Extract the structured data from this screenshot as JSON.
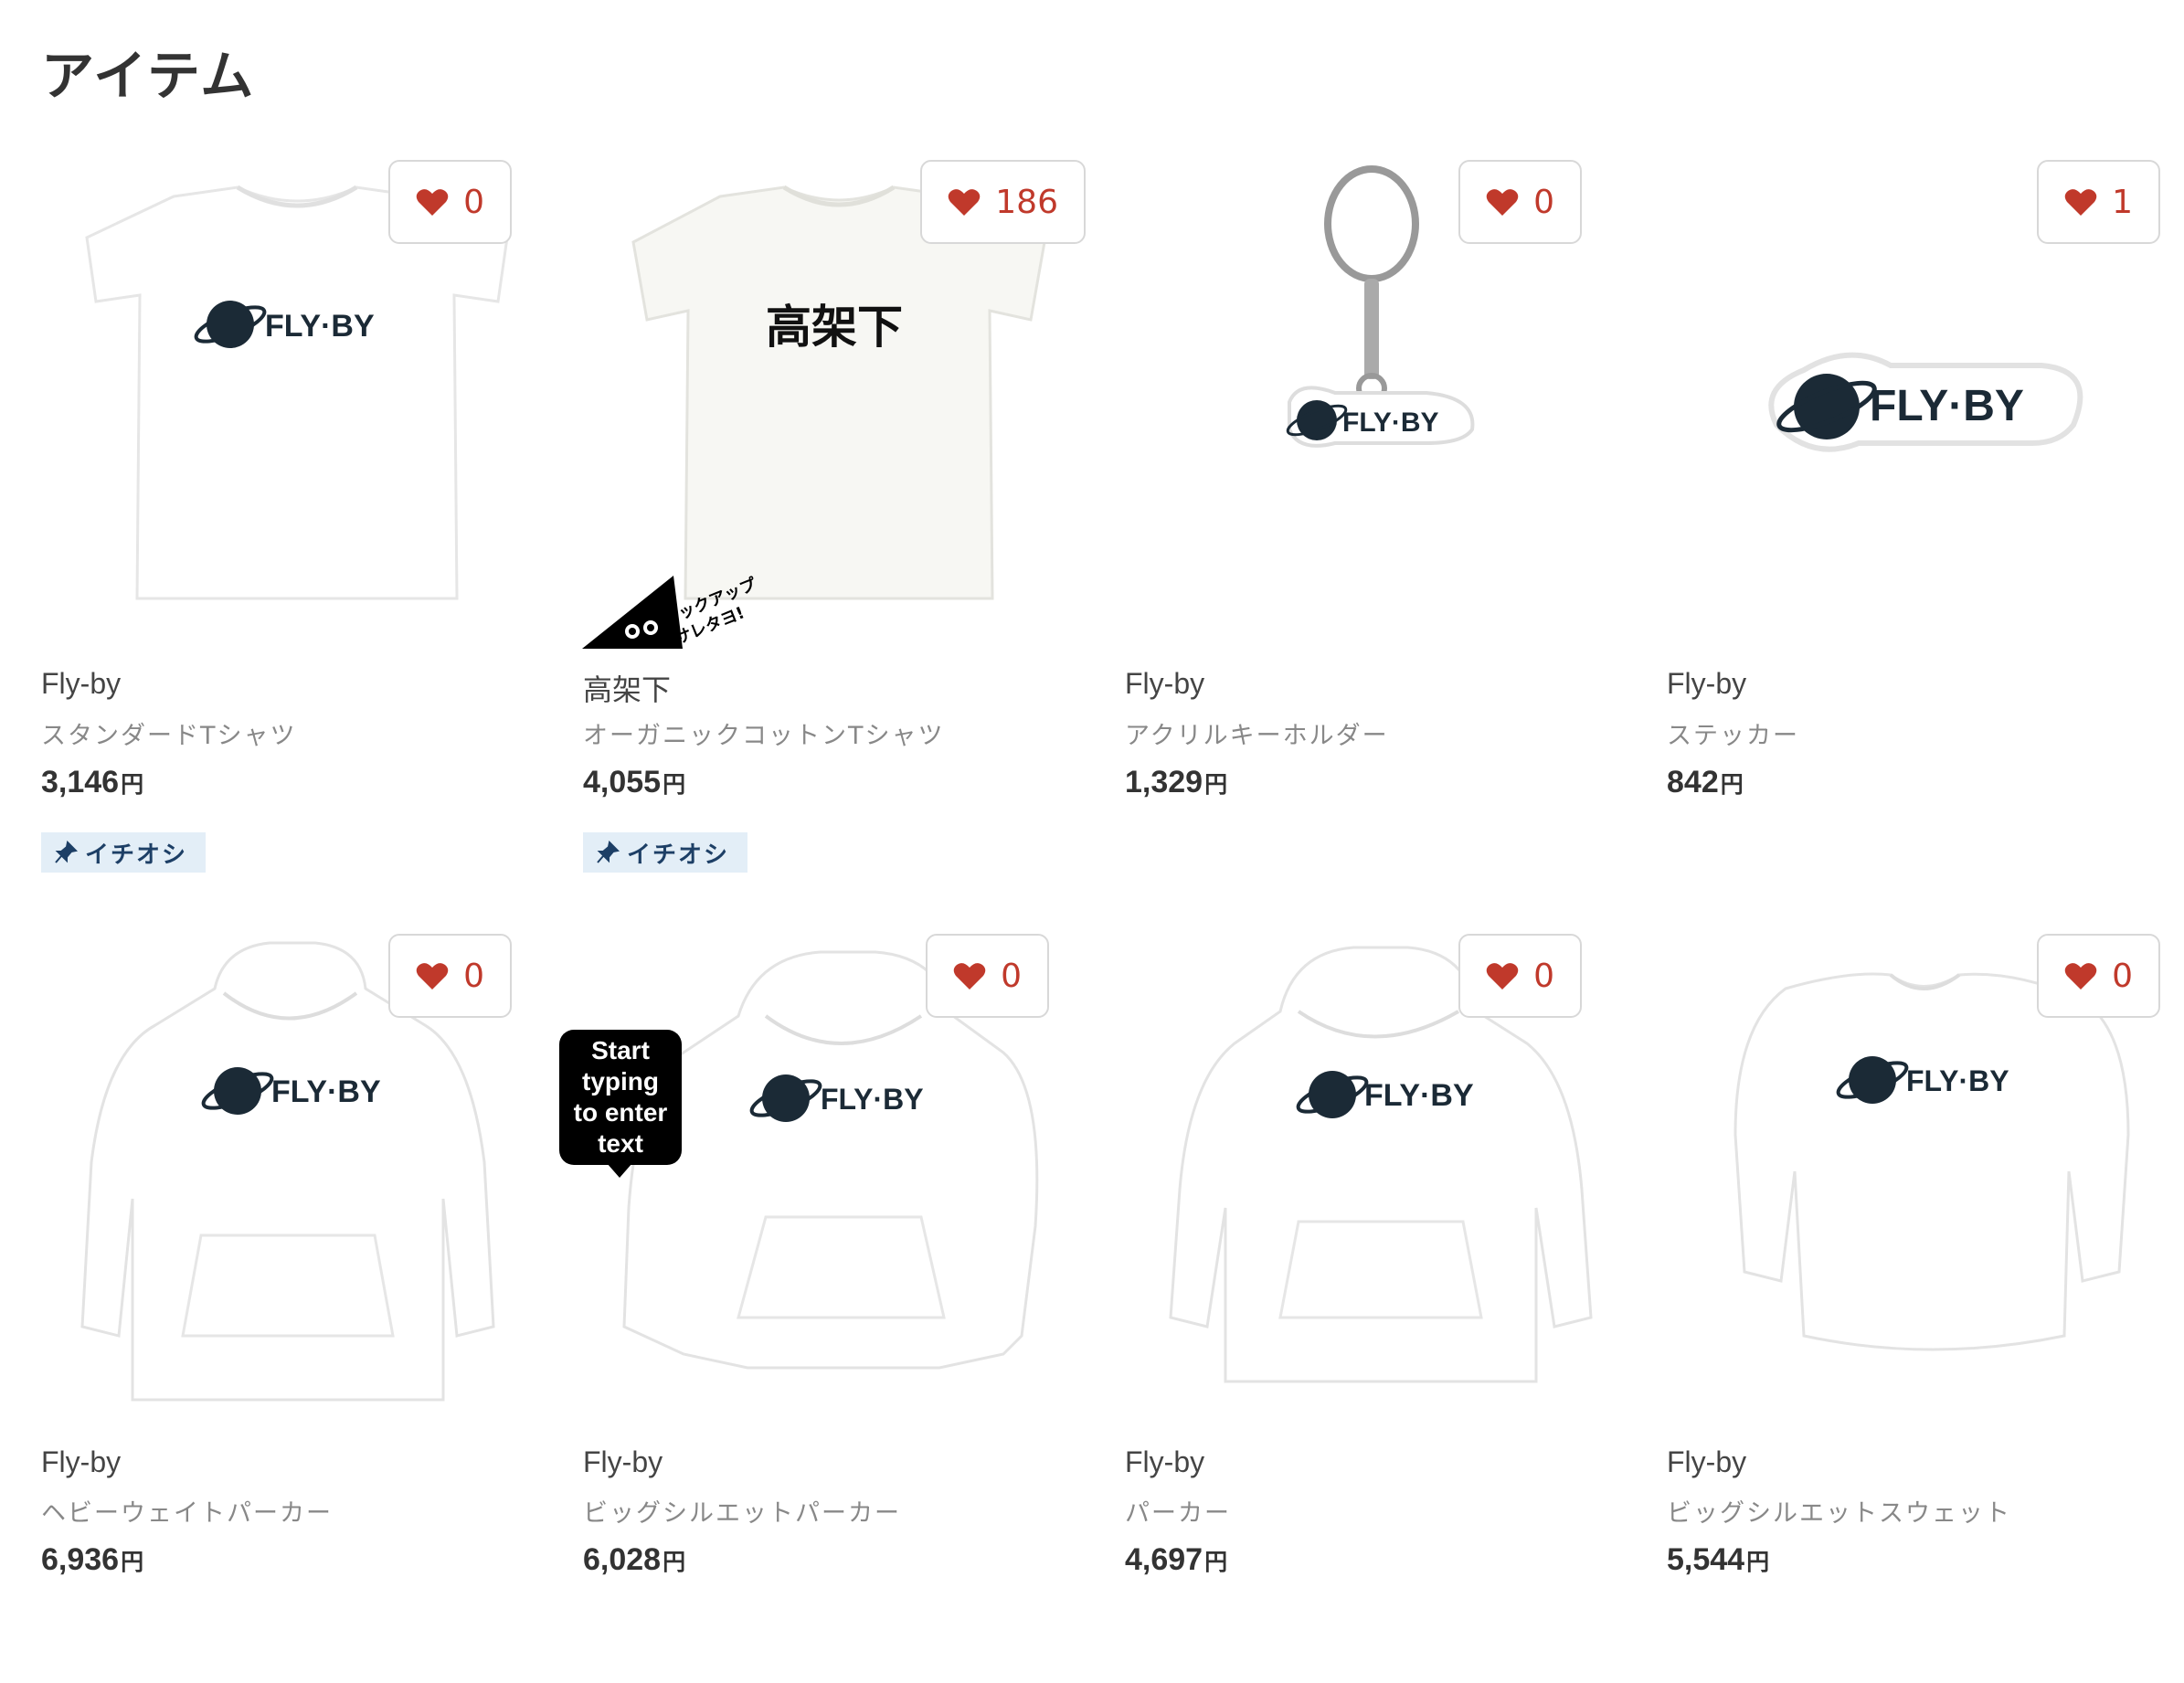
{
  "page": {
    "title": "アイテム"
  },
  "items": [
    {
      "shop": "Fly-by",
      "type": "スタンダードTシャツ",
      "price": "3,146",
      "currency": "円",
      "likes": "0",
      "badge": "イチオシ",
      "image": "tshirt",
      "print": "FLY·BY"
    },
    {
      "shop": "高架下",
      "type": "オーガニックコットンTシャツ",
      "price": "4,055",
      "currency": "円",
      "likes": "186",
      "badge": "イチオシ",
      "image": "tshirt",
      "print": "高架下"
    },
    {
      "shop": "Fly-by",
      "type": "アクリルキーホルダー",
      "price": "1,329",
      "currency": "円",
      "likes": "0",
      "badge": "",
      "image": "keychain",
      "print": "FLY·BY"
    },
    {
      "shop": "Fly-by",
      "type": "ステッカー",
      "price": "842",
      "currency": "円",
      "likes": "1",
      "badge": "",
      "image": "sticker",
      "print": "FLY·BY"
    },
    {
      "shop": "Fly-by",
      "type": "ヘビーウェイトパーカー",
      "price": "6,936",
      "currency": "円",
      "likes": "0",
      "badge": "",
      "image": "hoodie",
      "print": "FLY·BY"
    },
    {
      "shop": "Fly-by",
      "type": "ビッグシルエットパーカー",
      "price": "6,028",
      "currency": "円",
      "likes": "0",
      "badge": "",
      "image": "hoodie",
      "print": "FLY·BY"
    },
    {
      "shop": "Fly-by",
      "type": "パーカー",
      "price": "4,697",
      "currency": "円",
      "likes": "0",
      "badge": "",
      "image": "hoodie",
      "print": "FLY·BY"
    },
    {
      "shop": "Fly-by",
      "type": "ビッグシルエットスウェット",
      "price": "5,544",
      "currency": "円",
      "likes": "0",
      "badge": "",
      "image": "sweat",
      "print": "FLY·BY"
    }
  ],
  "tooltip": {
    "line1": "Start",
    "line2": "typing",
    "line3": "to enter",
    "line4": "text"
  },
  "pickup_ribbon": {
    "line1": "ピックアップ",
    "line2": "サレタヨ!"
  },
  "colors": {
    "heart": "#c0392b",
    "logo": "#1b2a36",
    "badge_bg": "#e3eef7",
    "badge_text": "#1d3f66"
  },
  "icons": {
    "like": "heart-icon",
    "badge": "pin-icon"
  }
}
